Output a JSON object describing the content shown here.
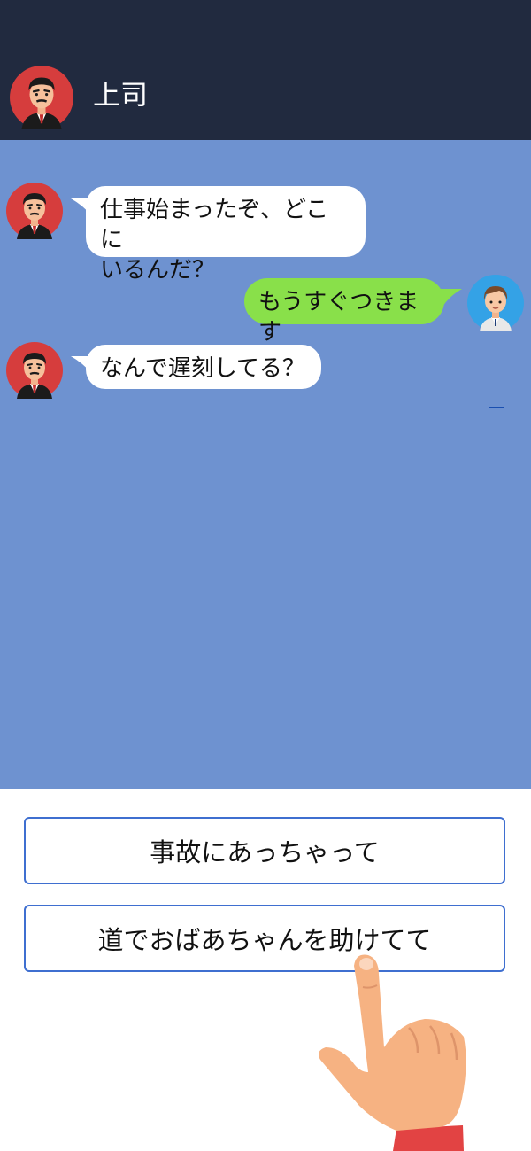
{
  "header": {
    "title": "上司"
  },
  "messages": [
    {
      "sender": "boss",
      "lines": [
        "仕事始まったぞ、どこに",
        "いるんだ？"
      ]
    },
    {
      "sender": "me",
      "lines": [
        "もうすぐつきます"
      ]
    },
    {
      "sender": "boss",
      "lines": [
        "なんで遅刻してる？"
      ]
    }
  ],
  "choices": [
    {
      "label": "事故にあっちゃって"
    },
    {
      "label": "道でおばあちゃんを助けてて"
    }
  ],
  "colors": {
    "header_bg": "#212a3f",
    "chat_bg": "#6e92d0",
    "my_bubble": "#89e04a",
    "choice_border": "#3f6fd0"
  }
}
